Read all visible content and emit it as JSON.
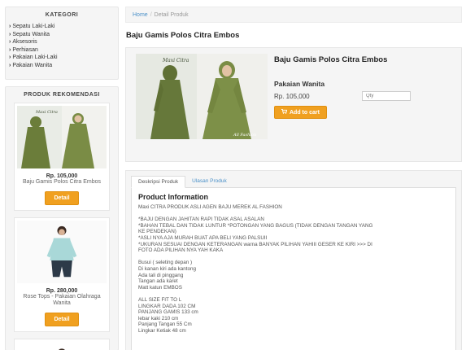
{
  "sidebar": {
    "categories_title": "KATEGORI",
    "categories": [
      "Sepatu Laki-Laki",
      "Sepatu Wanita",
      "Aksesoris",
      "Perhiasan",
      "Pakaian Laki-Laki",
      "Pakaian Wanita"
    ],
    "recommend_title": "PRODUK REKOMENDASI",
    "recommended": [
      {
        "price": "Rp. 105,000",
        "name": "Baju Gamis Polos Citra Embos",
        "button": "Detail"
      },
      {
        "price": "Rp. 280,000",
        "name": "Rose Tops - Pakaian Olahraga Wanita",
        "button": "Detail"
      }
    ]
  },
  "breadcrumb": {
    "home": "Home",
    "current": "Detail Produk"
  },
  "page_title": "Baju Gamis Polos Citra Embos",
  "product": {
    "image_brand": "Maxi Citra",
    "name": "Baju Gamis Polos Citra Embos",
    "category": "Pakaian Wanita",
    "price": "Rp. 105,000",
    "qty_placeholder": "Qty",
    "add_to_cart": "Add to cart"
  },
  "tabs": [
    "Deskripsi Produk",
    "Ulasan Produk"
  ],
  "description": {
    "heading": "Product Information",
    "lines": [
      "Maxi CITRA PRODUK ASLI AGEN BAJU MEREK AL FASHION",
      "",
      "*BAJU DENGAN JAHITAN RAPI TIDAK ASAL ASALAN",
      "*BAHAN TEBAL DAN TIDAK LUNTUR *POTONGAN YANG BAGUS (TIDAK DENGAN TANGAN YANG",
      "KE PENDEKAN)",
      "*ASLI NYA AJA MURAH BUAT APA BELI YANG PALSUII",
      "*UKURAN SESUAI DENGAN KETERANGAN warna BANYAK PILIHAN YAHIII GESER KE KIRI >>> DI",
      "FOTO ADA PILIHAN NYA YAH KAKA",
      "",
      "Busui ( seleting depan )",
      "Di kanan kiri ada kantong",
      "Ada tali di pinggang",
      "Tangan ada karet",
      "Matt katun EMBOS",
      "",
      "ALL SIZE FIT TO L",
      "LINGKAR DADA 102 CM",
      "PANJANG GAMIS 133 cm",
      "lebar kaki 210 cm",
      "Panjang Tangan 55 Cm",
      "Lingkar Ketiak 48 cm"
    ]
  }
}
